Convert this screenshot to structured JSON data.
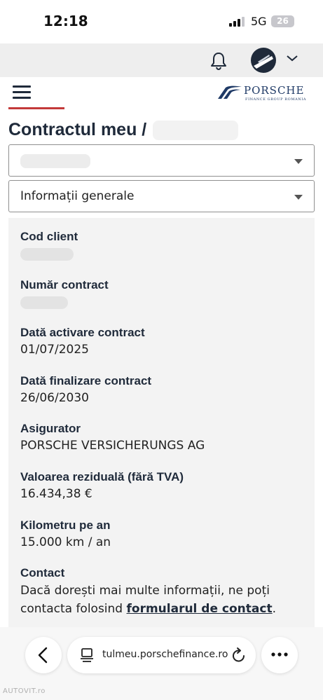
{
  "status_bar": {
    "time": "12:18",
    "network": "5G",
    "battery": "26"
  },
  "top_bar": {
    "notification_icon": "bell-icon",
    "avatar_icon": "avatar",
    "chevron_icon": "chevron-down-icon"
  },
  "header": {
    "menu_icon": "hamburger-menu-icon",
    "logo_text": "PORSCHE",
    "logo_subtext": "FINANCE GROUP ROMANIA",
    "accent_color": "#c33a3a"
  },
  "page": {
    "title": "Contractul meu /"
  },
  "selectors": {
    "contract_select_value": "",
    "section_select_value": "Informații generale"
  },
  "fields": [
    {
      "label": "Cod client",
      "value": ""
    },
    {
      "label": "Număr contract",
      "value": ""
    },
    {
      "label": "Dată activare contract",
      "value": "01/07/2025"
    },
    {
      "label": "Dată finalizare contract",
      "value": "26/06/2030"
    },
    {
      "label": "Asigurator",
      "value": "PORSCHE VERSICHERUNGS AG"
    },
    {
      "label": "Valoarea reziduală (fără TVA)",
      "value": "16.434,38 €"
    },
    {
      "label": "Kilometru pe an",
      "value": "15.000 km / an"
    }
  ],
  "contact": {
    "label": "Contact",
    "text_before": "Dacă dorești mai multe informații, ne poți contacta folosind ",
    "link_text": "formularul de contact",
    "text_after": "."
  },
  "browser": {
    "url": "tulmeu.porschefinance.ro",
    "back_icon": "chevron-left-icon",
    "site_icon": "site-settings-icon",
    "reload_icon": "reload-icon",
    "more_icon": "more-dots-icon"
  },
  "watermark": "AUTOVIT.ro"
}
